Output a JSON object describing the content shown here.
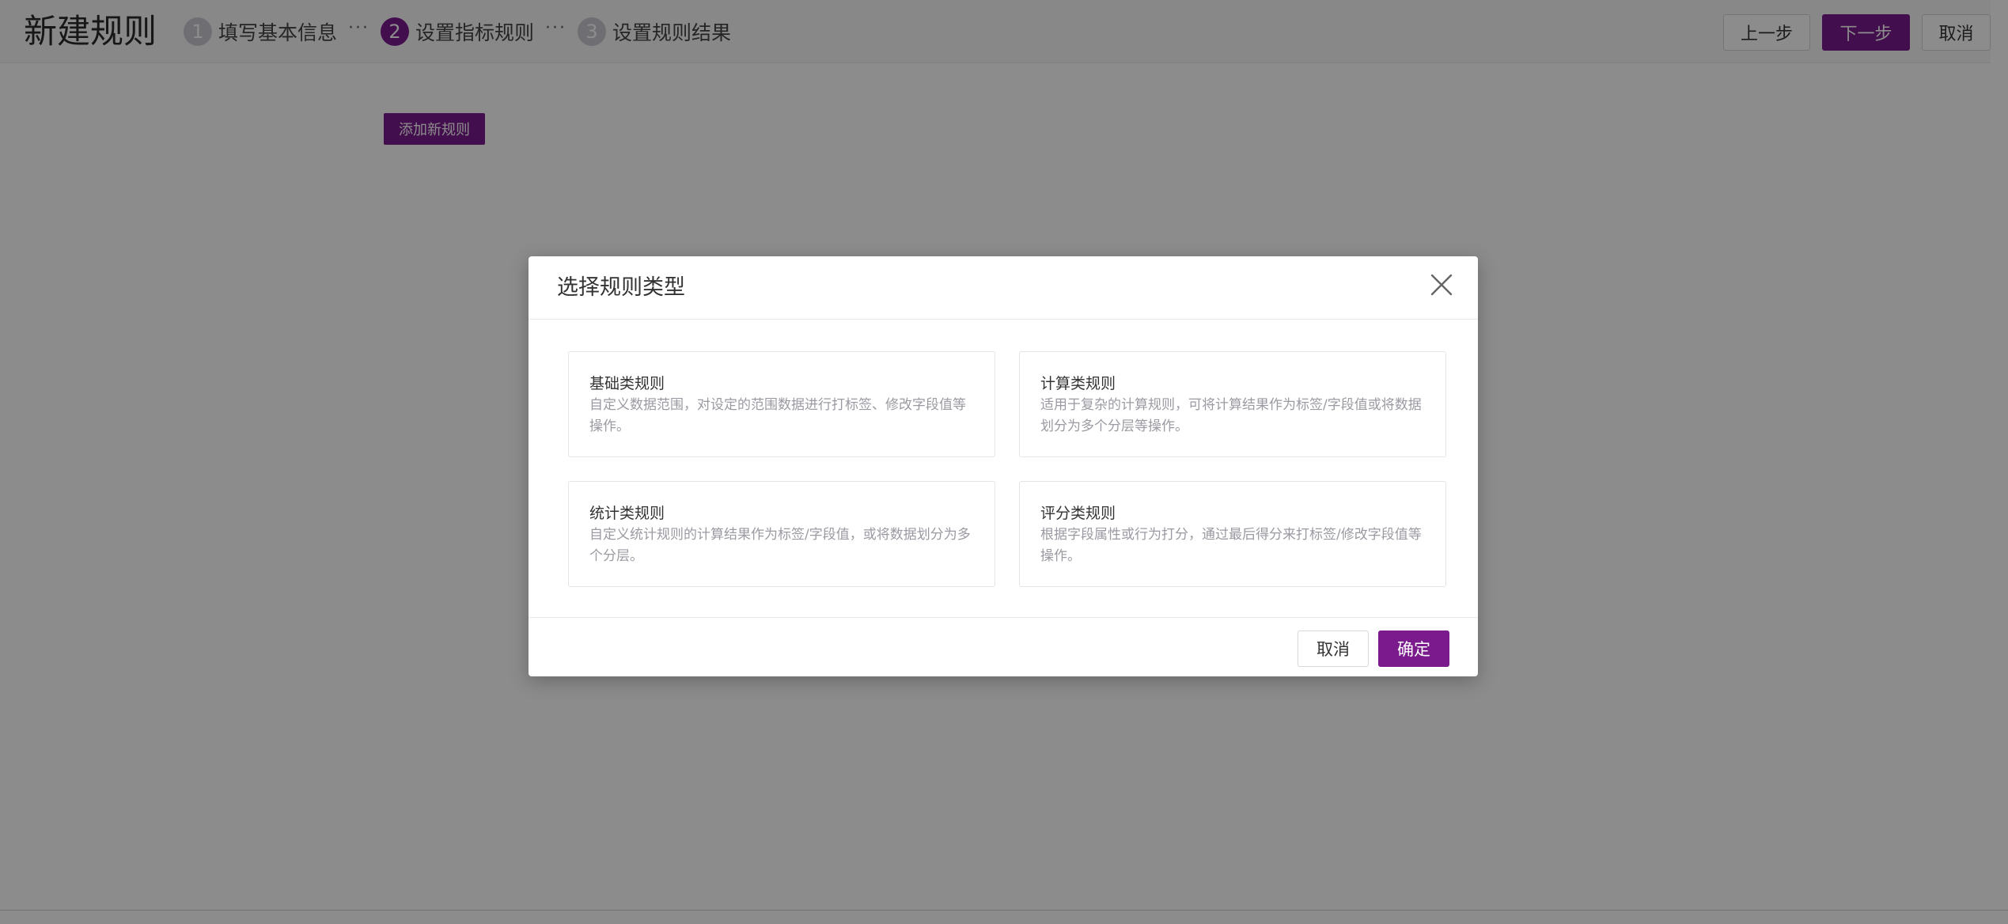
{
  "header": {
    "title": "新建规则",
    "steps": [
      {
        "num": "1",
        "label": "填写基本信息",
        "state": "done"
      },
      {
        "num": "2",
        "label": "设置指标规则",
        "state": "active"
      },
      {
        "num": "3",
        "label": "设置规则结果",
        "state": "pending"
      }
    ],
    "step_separator": "···",
    "buttons": {
      "prev": "上一步",
      "next": "下一步",
      "cancel": "取消"
    }
  },
  "main": {
    "add_rule_label": "添加新规则"
  },
  "modal": {
    "title": "选择规则类型",
    "cards": [
      {
        "title": "基础类规则",
        "desc": "自定义数据范围，对设定的范围数据进行打标签、修改字段值等操作。"
      },
      {
        "title": "计算类规则",
        "desc": "适用于复杂的计算规则，可将计算结果作为标签/字段值或将数据划分为多个分层等操作。"
      },
      {
        "title": "统计类规则",
        "desc": "自定义统计规则的计算结果作为标签/字段值，或将数据划分为多个分层。"
      },
      {
        "title": "评分类规则",
        "desc": "根据字段属性或行为打分，通过最后得分来打标签/修改字段值等操作。"
      }
    ],
    "footer": {
      "cancel": "取消",
      "confirm": "确定"
    }
  },
  "colors": {
    "primary": "#7a1a8c",
    "mask": "rgba(0,0,0,0.45)",
    "step_inactive": "#c9c9d2"
  },
  "icons": {
    "close": "close-icon"
  }
}
